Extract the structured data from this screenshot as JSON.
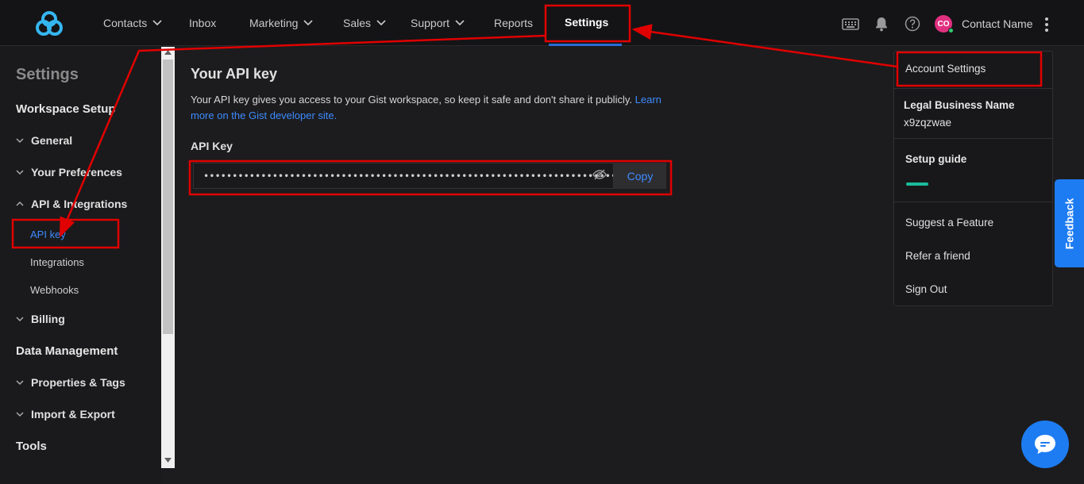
{
  "nav": {
    "items": [
      {
        "label": "Contacts",
        "has_menu": true
      },
      {
        "label": "Inbox",
        "has_menu": false
      },
      {
        "label": "Marketing",
        "has_menu": true
      },
      {
        "label": "Sales",
        "has_menu": true
      },
      {
        "label": "Support",
        "has_menu": true
      },
      {
        "label": "Reports",
        "has_menu": false
      },
      {
        "label": "Settings",
        "has_menu": false,
        "active": true
      }
    ],
    "avatar_initials": "CO",
    "contact_name": "Contact Name"
  },
  "sidebar": {
    "title": "Settings",
    "workspace_setup": "Workspace Setup",
    "general": "General",
    "your_preferences": "Your Preferences",
    "api_integrations": "API & Integrations",
    "api_key": "API key",
    "integrations": "Integrations",
    "webhooks": "Webhooks",
    "billing": "Billing",
    "data_management": "Data Management",
    "properties_tags": "Properties & Tags",
    "import_export": "Import & Export",
    "tools": "Tools"
  },
  "main": {
    "title": "Your API key",
    "description": "Your API key gives you access to your Gist workspace, so keep it safe and don't share it publicly.",
    "link_text": "Learn more on the Gist developer site.",
    "field_label": "API Key",
    "masked_key": "••••••••••••••••••••••••••••••••••••••••••••••••••••••••••••••••••••••••",
    "copy_label": "Copy"
  },
  "dropdown": {
    "account_settings": "Account Settings",
    "legal_business_name_label": "Legal Business Name",
    "legal_business_name_value": "x9zqzwae",
    "setup_guide": "Setup guide",
    "suggest_feature": "Suggest a Feature",
    "refer_friend": "Refer a friend",
    "sign_out": "Sign Out"
  },
  "feedback_label": "Feedback",
  "colors": {
    "accent": "#3d8bff",
    "highlight": "#e00000",
    "brand": "#1e7cf2"
  }
}
